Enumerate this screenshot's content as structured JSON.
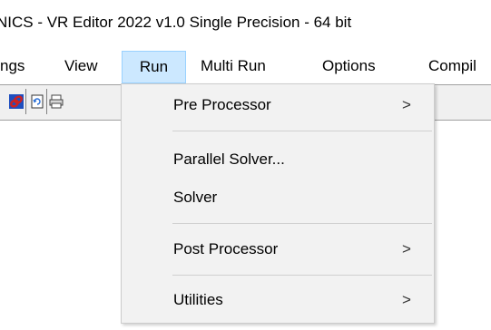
{
  "window": {
    "title": "NICS - VR Editor 2022 v1.0 Single Precision - 64 bit"
  },
  "menubar": {
    "items": [
      "ngs",
      "View",
      "Run",
      "Multi Run",
      "Options",
      "Compil"
    ],
    "active": "Run"
  },
  "toolbar": {
    "buttons": [
      "red-link-icon",
      "refresh-document-icon",
      "print-icon"
    ]
  },
  "run_menu": {
    "items": [
      {
        "label": "Pre Processor",
        "submenu_arrow": ">"
      },
      {
        "label": "Parallel Solver..."
      },
      {
        "label": "Solver"
      },
      {
        "label": "Post Processor",
        "submenu_arrow": ">"
      },
      {
        "label": "Utilities",
        "submenu_arrow": ">"
      }
    ]
  },
  "colors": {
    "menu_highlight": "#cce8ff",
    "menu_highlight_border": "#99d1ff",
    "dropdown_bg": "#f2f2f2",
    "toolbar_bg": "#f0f0f0",
    "link_icon_red": "#cc2222",
    "link_icon_blue": "#1f4fbf"
  }
}
